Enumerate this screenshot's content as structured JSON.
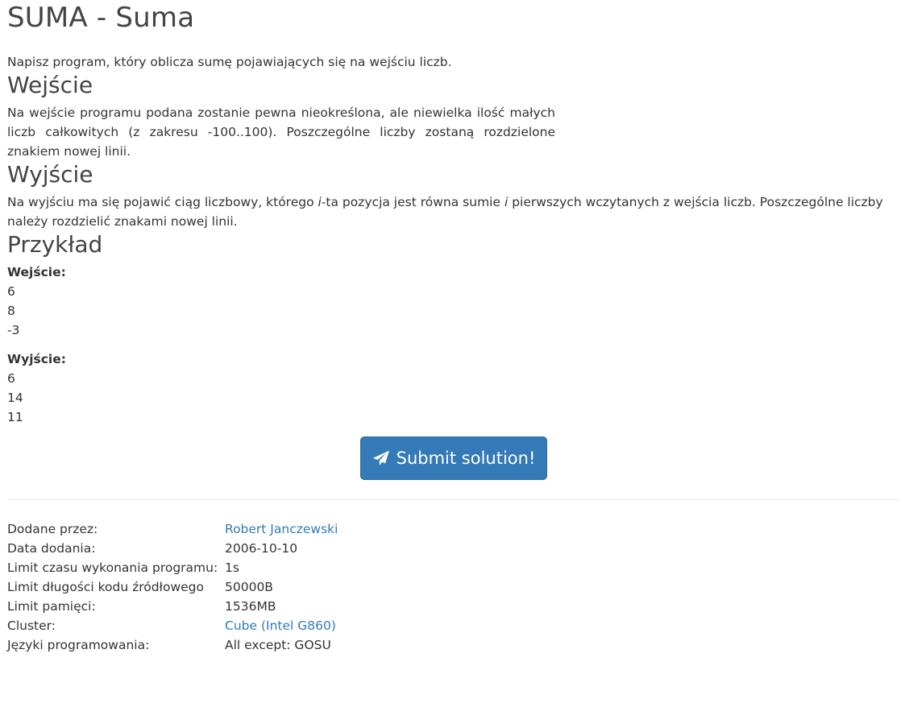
{
  "problem": {
    "title": "SUMA - Suma",
    "intro": "Napisz program, który oblicza sumę pojawiających się na wejściu liczb."
  },
  "input_section": {
    "heading": "Wejście",
    "text": "Na wejście programu podana zostanie pewna nieokreślona, ale niewielka ilość małych liczb całkowitych (z zakresu -100..100). Poszczególne liczby zostaną rozdzielone znakiem nowej linii."
  },
  "output_section": {
    "heading": "Wyjście",
    "text_part1": "Na wyjściu ma się pojawić ciąg liczbowy, którego ",
    "var1": "i",
    "text_part2": "-ta pozycja jest równa sumie ",
    "var2": "i",
    "text_part3": " pierwszych wczytanych z wejścia liczb. Poszczególne liczby należy rozdzielić znakami nowej linii."
  },
  "example": {
    "heading": "Przykład",
    "input_label": "Wejście:",
    "input_lines": [
      "6",
      "8",
      "-3"
    ],
    "output_label": "Wyjście:",
    "output_lines": [
      "6",
      "14",
      "11"
    ]
  },
  "submit": {
    "label": "Submit solution!",
    "icon": "paper-plane-icon",
    "color": "#337ab7"
  },
  "meta": {
    "added_by_label": "Dodane przez:",
    "added_by_value": "Robert Janczewski",
    "date_label": "Data dodania:",
    "date_value": "2006-10-10",
    "time_limit_label": "Limit czasu wykonania programu:",
    "time_limit_value": "1s",
    "code_limit_label": "Limit długości kodu źródłowego",
    "code_limit_value": "50000B",
    "memory_label": "Limit pamięci:",
    "memory_value": "1536MB",
    "cluster_label": "Cluster:",
    "cluster_value": "Cube (Intel G860)",
    "languages_label": "Języki programowania:",
    "languages_value": "All except: GOSU"
  },
  "colors": {
    "link": "#337ab7",
    "text": "#333333",
    "button": "#337ab7"
  }
}
